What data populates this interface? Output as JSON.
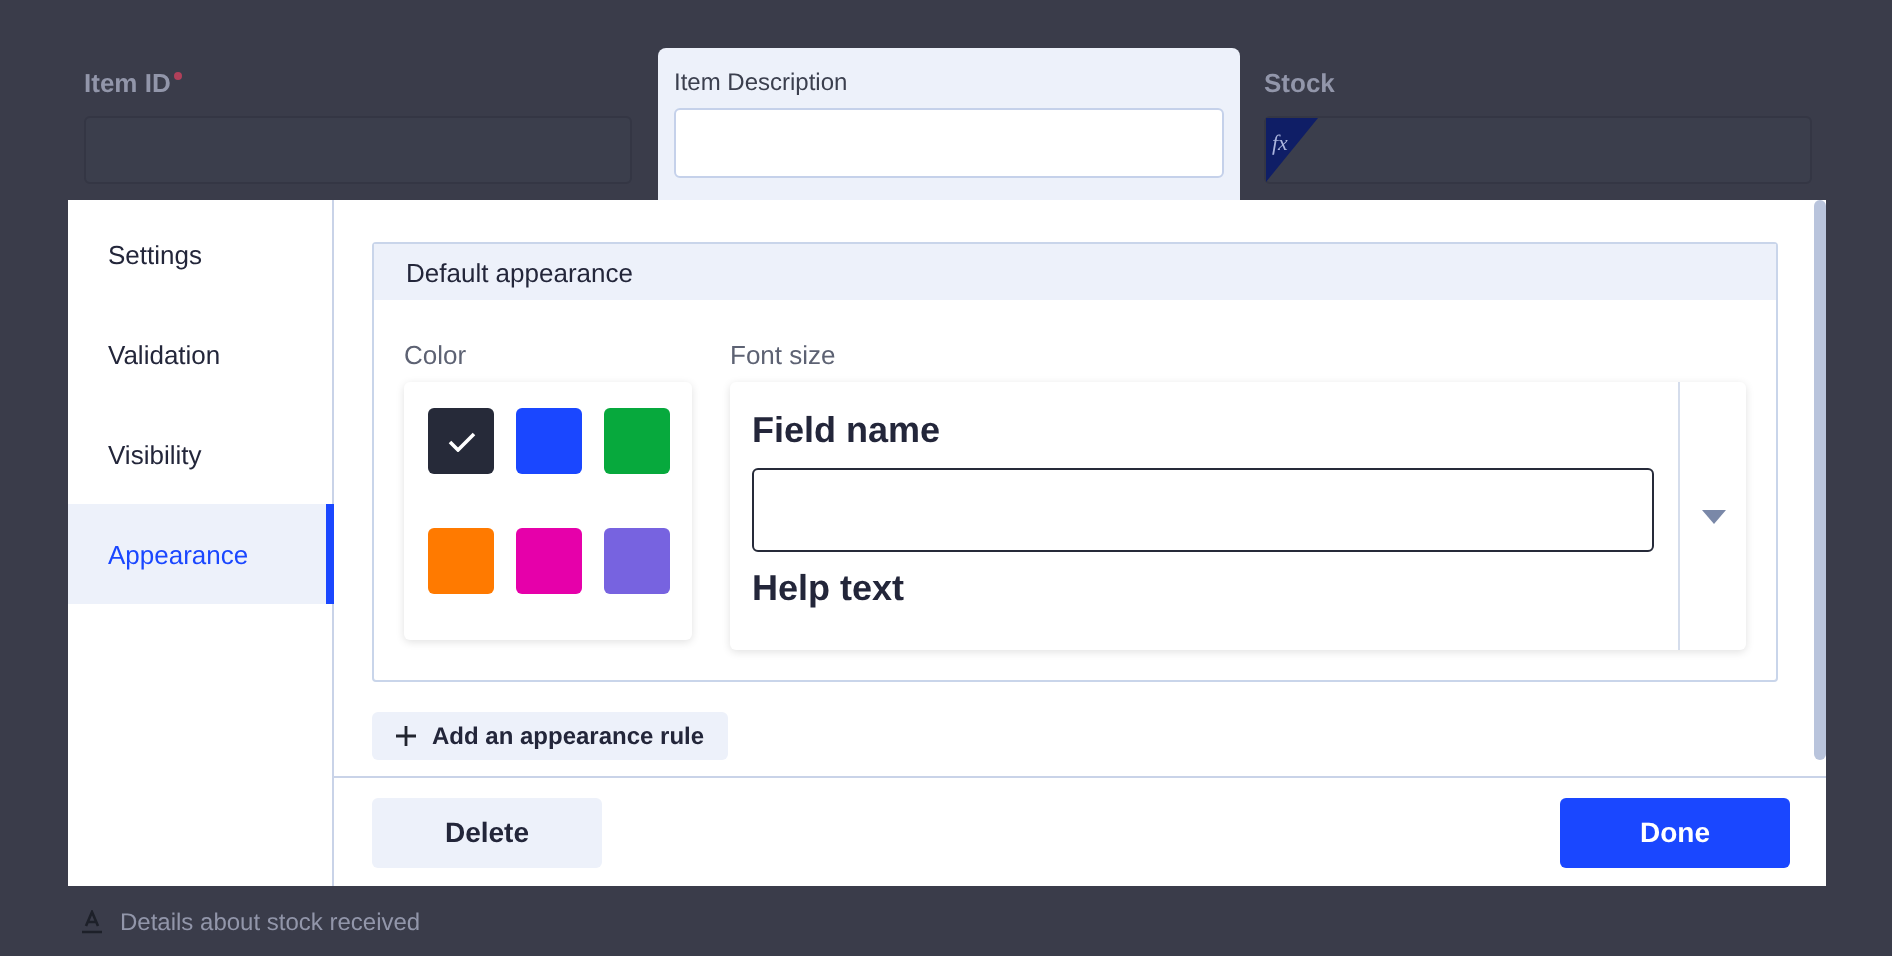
{
  "background_form": {
    "fields": [
      {
        "label": "Item ID",
        "required": true,
        "kind": "text"
      },
      {
        "label": "Stock",
        "kind": "formula",
        "formula_label": "fx"
      }
    ],
    "footer_hint": "Details about stock received"
  },
  "focused_field": {
    "label": "Item Description"
  },
  "modal": {
    "nav": [
      {
        "label": "Settings",
        "selected": false
      },
      {
        "label": "Validation",
        "selected": false
      },
      {
        "label": "Visibility",
        "selected": false
      },
      {
        "label": "Appearance",
        "selected": true
      }
    ],
    "panel_title": "Default appearance",
    "color_label": "Color",
    "colors": [
      {
        "color": "#262a39",
        "selected": true
      },
      {
        "color": "#1a47ff",
        "selected": false
      },
      {
        "color": "#07a93d",
        "selected": false
      },
      {
        "color": "#ff7a00",
        "selected": false
      },
      {
        "color": "#e600aa",
        "selected": false
      },
      {
        "color": "#7763e0",
        "selected": false
      }
    ],
    "font_size_label": "Font size",
    "preview": {
      "field_name": "Field name",
      "help_text": "Help text"
    },
    "add_rule_button": "Add an appearance rule",
    "delete_button": "Delete",
    "done_button": "Done"
  }
}
